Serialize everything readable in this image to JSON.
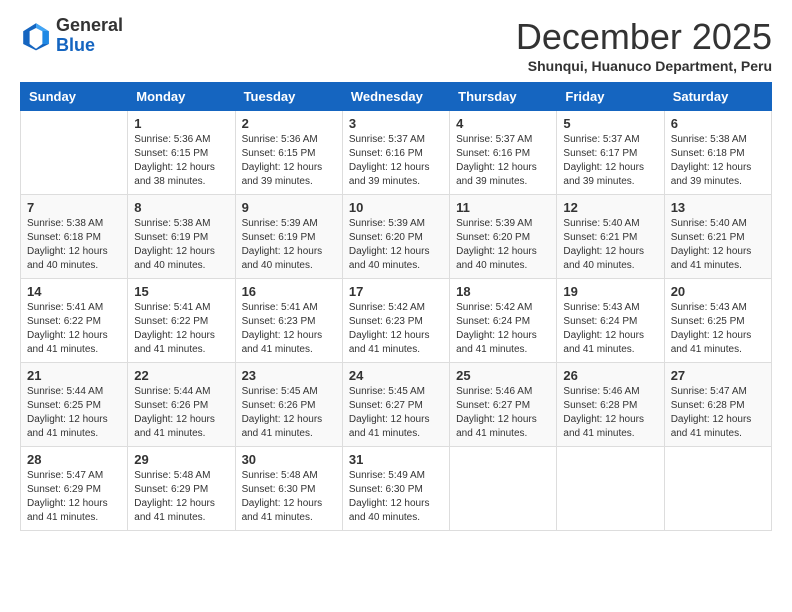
{
  "logo": {
    "general": "General",
    "blue": "Blue"
  },
  "title": "December 2025",
  "subtitle": "Shunqui, Huanuco Department, Peru",
  "days_of_week": [
    "Sunday",
    "Monday",
    "Tuesday",
    "Wednesday",
    "Thursday",
    "Friday",
    "Saturday"
  ],
  "weeks": [
    [
      {
        "day": "",
        "info": ""
      },
      {
        "day": "1",
        "info": "Sunrise: 5:36 AM\nSunset: 6:15 PM\nDaylight: 12 hours\nand 38 minutes."
      },
      {
        "day": "2",
        "info": "Sunrise: 5:36 AM\nSunset: 6:15 PM\nDaylight: 12 hours\nand 39 minutes."
      },
      {
        "day": "3",
        "info": "Sunrise: 5:37 AM\nSunset: 6:16 PM\nDaylight: 12 hours\nand 39 minutes."
      },
      {
        "day": "4",
        "info": "Sunrise: 5:37 AM\nSunset: 6:16 PM\nDaylight: 12 hours\nand 39 minutes."
      },
      {
        "day": "5",
        "info": "Sunrise: 5:37 AM\nSunset: 6:17 PM\nDaylight: 12 hours\nand 39 minutes."
      },
      {
        "day": "6",
        "info": "Sunrise: 5:38 AM\nSunset: 6:18 PM\nDaylight: 12 hours\nand 39 minutes."
      }
    ],
    [
      {
        "day": "7",
        "info": "Sunrise: 5:38 AM\nSunset: 6:18 PM\nDaylight: 12 hours\nand 40 minutes."
      },
      {
        "day": "8",
        "info": "Sunrise: 5:38 AM\nSunset: 6:19 PM\nDaylight: 12 hours\nand 40 minutes."
      },
      {
        "day": "9",
        "info": "Sunrise: 5:39 AM\nSunset: 6:19 PM\nDaylight: 12 hours\nand 40 minutes."
      },
      {
        "day": "10",
        "info": "Sunrise: 5:39 AM\nSunset: 6:20 PM\nDaylight: 12 hours\nand 40 minutes."
      },
      {
        "day": "11",
        "info": "Sunrise: 5:39 AM\nSunset: 6:20 PM\nDaylight: 12 hours\nand 40 minutes."
      },
      {
        "day": "12",
        "info": "Sunrise: 5:40 AM\nSunset: 6:21 PM\nDaylight: 12 hours\nand 40 minutes."
      },
      {
        "day": "13",
        "info": "Sunrise: 5:40 AM\nSunset: 6:21 PM\nDaylight: 12 hours\nand 41 minutes."
      }
    ],
    [
      {
        "day": "14",
        "info": "Sunrise: 5:41 AM\nSunset: 6:22 PM\nDaylight: 12 hours\nand 41 minutes."
      },
      {
        "day": "15",
        "info": "Sunrise: 5:41 AM\nSunset: 6:22 PM\nDaylight: 12 hours\nand 41 minutes."
      },
      {
        "day": "16",
        "info": "Sunrise: 5:41 AM\nSunset: 6:23 PM\nDaylight: 12 hours\nand 41 minutes."
      },
      {
        "day": "17",
        "info": "Sunrise: 5:42 AM\nSunset: 6:23 PM\nDaylight: 12 hours\nand 41 minutes."
      },
      {
        "day": "18",
        "info": "Sunrise: 5:42 AM\nSunset: 6:24 PM\nDaylight: 12 hours\nand 41 minutes."
      },
      {
        "day": "19",
        "info": "Sunrise: 5:43 AM\nSunset: 6:24 PM\nDaylight: 12 hours\nand 41 minutes."
      },
      {
        "day": "20",
        "info": "Sunrise: 5:43 AM\nSunset: 6:25 PM\nDaylight: 12 hours\nand 41 minutes."
      }
    ],
    [
      {
        "day": "21",
        "info": "Sunrise: 5:44 AM\nSunset: 6:25 PM\nDaylight: 12 hours\nand 41 minutes."
      },
      {
        "day": "22",
        "info": "Sunrise: 5:44 AM\nSunset: 6:26 PM\nDaylight: 12 hours\nand 41 minutes."
      },
      {
        "day": "23",
        "info": "Sunrise: 5:45 AM\nSunset: 6:26 PM\nDaylight: 12 hours\nand 41 minutes."
      },
      {
        "day": "24",
        "info": "Sunrise: 5:45 AM\nSunset: 6:27 PM\nDaylight: 12 hours\nand 41 minutes."
      },
      {
        "day": "25",
        "info": "Sunrise: 5:46 AM\nSunset: 6:27 PM\nDaylight: 12 hours\nand 41 minutes."
      },
      {
        "day": "26",
        "info": "Sunrise: 5:46 AM\nSunset: 6:28 PM\nDaylight: 12 hours\nand 41 minutes."
      },
      {
        "day": "27",
        "info": "Sunrise: 5:47 AM\nSunset: 6:28 PM\nDaylight: 12 hours\nand 41 minutes."
      }
    ],
    [
      {
        "day": "28",
        "info": "Sunrise: 5:47 AM\nSunset: 6:29 PM\nDaylight: 12 hours\nand 41 minutes."
      },
      {
        "day": "29",
        "info": "Sunrise: 5:48 AM\nSunset: 6:29 PM\nDaylight: 12 hours\nand 41 minutes."
      },
      {
        "day": "30",
        "info": "Sunrise: 5:48 AM\nSunset: 6:30 PM\nDaylight: 12 hours\nand 41 minutes."
      },
      {
        "day": "31",
        "info": "Sunrise: 5:49 AM\nSunset: 6:30 PM\nDaylight: 12 hours\nand 40 minutes."
      },
      {
        "day": "",
        "info": ""
      },
      {
        "day": "",
        "info": ""
      },
      {
        "day": "",
        "info": ""
      }
    ]
  ]
}
